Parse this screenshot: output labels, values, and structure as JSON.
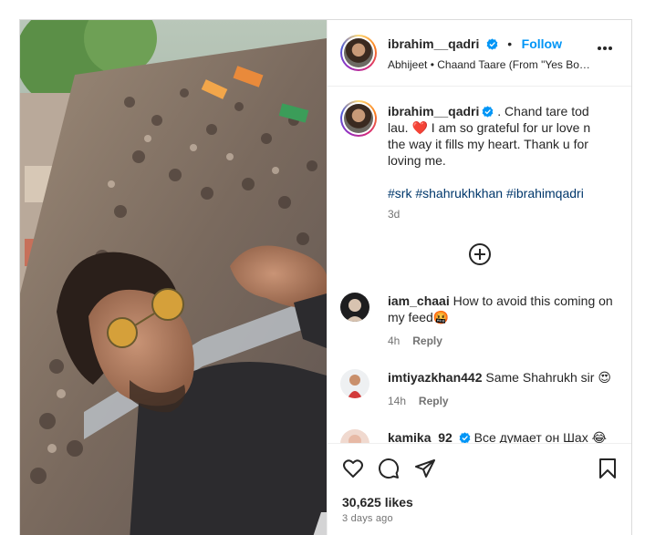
{
  "post": {
    "username": "ibrahim__qadri",
    "follow_label": "Follow",
    "separator": "•",
    "audio": "Abhijeet • Chaand Taare (From \"Yes Bo…"
  },
  "caption": {
    "username": "ibrahim__qadri",
    "text_part1": " . Chand tare tod lau. ",
    "heart": "❤️",
    "text_part2": " I am so grateful for ur love n the way it fills my heart. Thank u for loving me.",
    "hashtags": [
      "#srk",
      "#shahrukhkhan",
      "#ibrahimqadri"
    ],
    "age": "3d"
  },
  "comments": [
    {
      "username": "iam_chaai",
      "text": "How to avoid this coming on my feed",
      "emoji": "🤬",
      "age": "4h",
      "reply_label": "Reply",
      "verified": false
    },
    {
      "username": "imtiyazkhan442",
      "text": "Same Shahrukh sir",
      "emoji": "😍",
      "age": "14h",
      "reply_label": "Reply",
      "verified": false
    },
    {
      "username": "kamika_92",
      "text": "Все думает он Шах",
      "emoji": "😂",
      "age": "",
      "reply_label": "",
      "verified": true
    }
  ],
  "footer": {
    "likes": "30,625 likes",
    "posted": "3 days ago"
  },
  "colors": {
    "link_blue": "#0095f6",
    "hashtag_blue": "#00376b",
    "heart_red": "#ed4956",
    "verified_blue": "#0095f6",
    "muted": "#737373"
  },
  "icons": [
    "heart-icon",
    "comment-icon",
    "share-icon",
    "bookmark-icon",
    "more-icon",
    "add-icon",
    "verified-icon"
  ]
}
